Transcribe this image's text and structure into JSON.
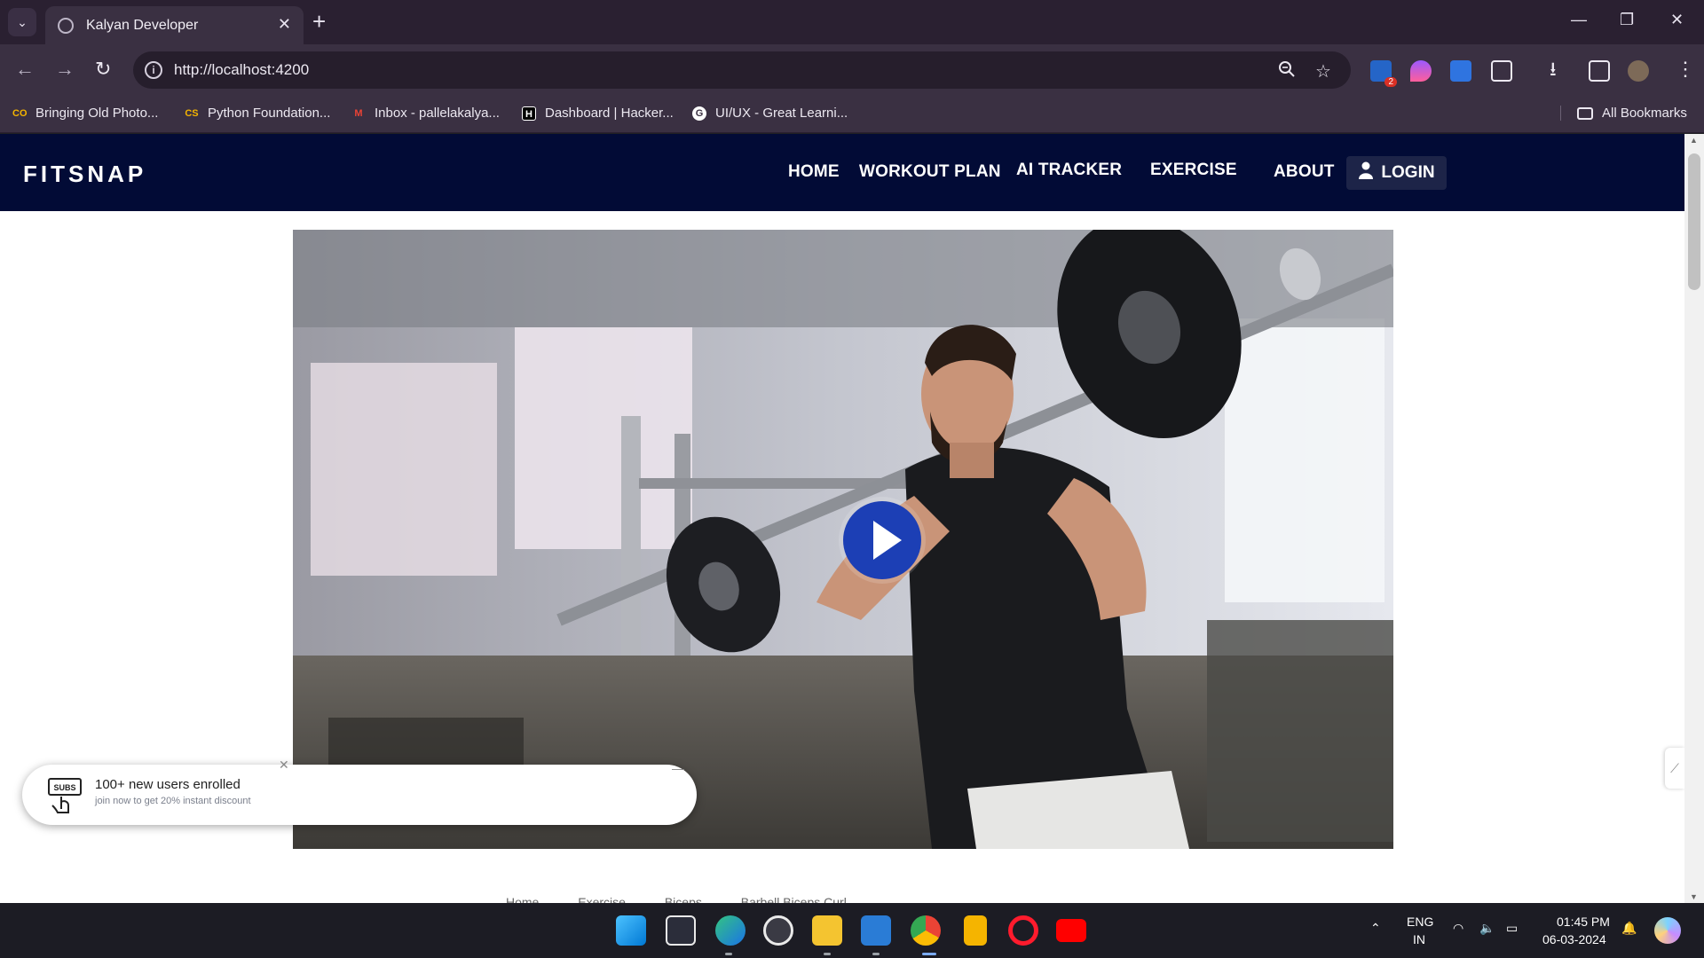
{
  "browser": {
    "tab_title": "Kalyan Developer",
    "url": "http://localhost:4200",
    "bookmarks": [
      {
        "label": "Bringing Old Photo...",
        "icon": "co-icon",
        "color": "#f4b400"
      },
      {
        "label": "Python Foundation...",
        "icon": "cs-icon",
        "color": "#f4b400"
      },
      {
        "label": "Inbox - pallelakalya...",
        "icon": "gmail-icon",
        "color": "#ea4335"
      },
      {
        "label": "Dashboard | Hacker...",
        "icon": "hackerrank-icon",
        "color": "#000000"
      },
      {
        "label": "UI/UX - Great Learni...",
        "icon": "google-icon",
        "color": "#ffffff"
      }
    ],
    "all_bookmarks": "All Bookmarks",
    "extension_badge": "2"
  },
  "site": {
    "logo": "FITSNAP",
    "nav": {
      "home": "HOME",
      "workout": "WORKOUT PLAN",
      "ai": "AI TRACKER",
      "exercise": "EXERCISE",
      "about": "ABOUT",
      "login": "LOGIN"
    },
    "toast": {
      "badge": "SUBS",
      "title": "100+ new users enrolled",
      "subtitle": "join now to get 20% instant discount"
    },
    "breadcrumbs": [
      "Home",
      "Exercise",
      "Biceps",
      "Barbell Biceps Curl"
    ]
  },
  "taskbar": {
    "lang_top": "ENG",
    "lang_bottom": "IN",
    "time": "01:45 PM",
    "date": "06-03-2024"
  },
  "colors": {
    "site_nav_bg": "#020b36",
    "play_button": "#1c3fb5",
    "browser_frame": "#3a3042"
  }
}
